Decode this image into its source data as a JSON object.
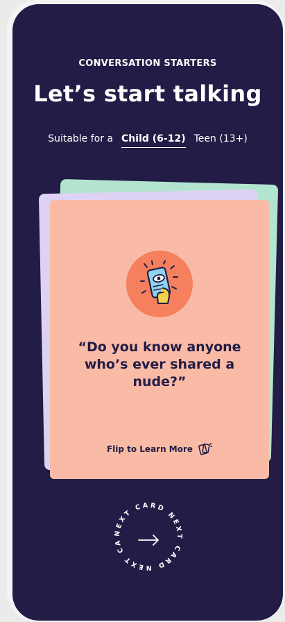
{
  "header": {
    "eyebrow": "CONVERSATION STARTERS",
    "title": "Let’s start talking"
  },
  "audience": {
    "label": "Suitable for a",
    "options": [
      {
        "label": "Child (6-12)",
        "active": true
      },
      {
        "label": "Teen (13+)",
        "active": false
      }
    ]
  },
  "card": {
    "icon": "phone-eye-icon",
    "question": "“Do you know anyone who’s ever shared a nude?”",
    "flip_label": "Flip to Learn More",
    "flip_icon": "flip-cards-icon"
  },
  "next_button": {
    "ring_text": "NEXT CARD NEXT CARD NEXT CARD",
    "icon": "arrow-right-icon"
  },
  "colors": {
    "background": "#221c46",
    "card_front": "#f9bba6",
    "card_back_green": "#b3e4cf",
    "card_back_lilac": "#ddd2f4",
    "icon_circle": "#f5805d"
  }
}
